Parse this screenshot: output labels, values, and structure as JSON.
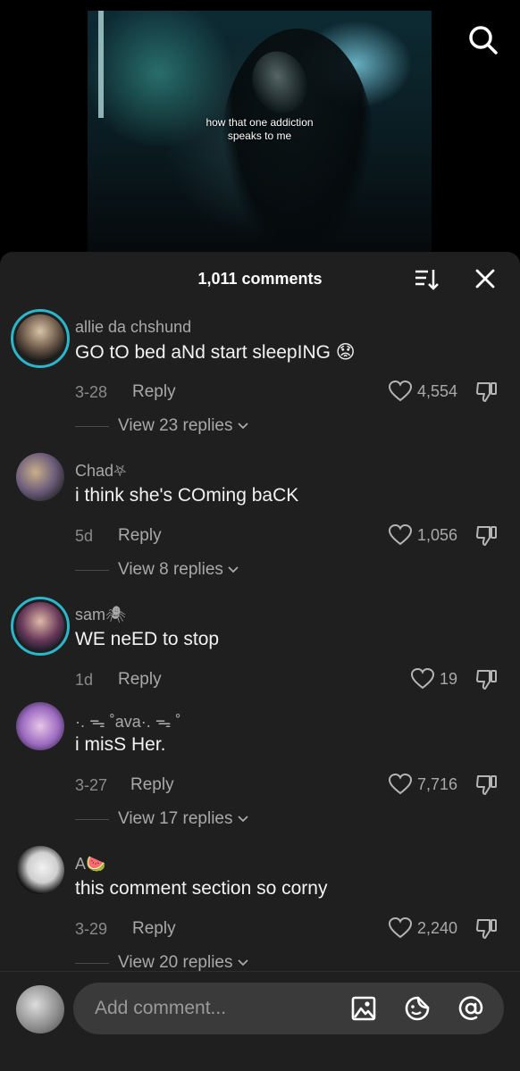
{
  "video": {
    "caption_line1": "how that one addiction",
    "caption_line2": "speaks to me"
  },
  "icons": {
    "search": "search-icon",
    "sort": "sort-icon",
    "close": "close-icon",
    "like": "heart-icon",
    "dislike": "thumbs-down-icon",
    "image": "image-icon",
    "emoji": "emoji-sticker-icon",
    "mention": "at-mention-icon"
  },
  "header": {
    "comment_count": "1,011 comments"
  },
  "comments": [
    {
      "username": "allie da chshund",
      "text": "GO tO bed aNd start sleepING 😟",
      "date": "3-28",
      "reply": "Reply",
      "likes": "4,554",
      "view_replies": "View 23 replies",
      "avatar_ring": true
    },
    {
      "username": "Chad⛧",
      "text": "i think she's COming baCK",
      "date": "5d",
      "reply": "Reply",
      "likes": "1,056",
      "view_replies": "View 8 replies",
      "avatar_ring": false
    },
    {
      "username": "sam🕷",
      "text": "WE neED to stop",
      "date": "1d",
      "reply": "Reply",
      "likes": "19",
      "view_replies": "",
      "avatar_ring": true
    },
    {
      "username": "·. ᯓ ˚ava·. ᯓ ˚",
      "text": "i misS Her.",
      "date": "3-27",
      "reply": "Reply",
      "likes": "7,716",
      "view_replies": "View 17 replies",
      "avatar_ring": false
    },
    {
      "username": "A🍉",
      "text": "this comment section so corny",
      "date": "3-29",
      "reply": "Reply",
      "likes": "2,240",
      "view_replies": "View 20 replies",
      "avatar_ring": false
    }
  ],
  "input": {
    "placeholder": "Add comment..."
  },
  "colors": {
    "accent_ring": "#2bb6c9",
    "sheet_bg": "#1f1f1f",
    "input_bg": "#3a3a3a"
  }
}
